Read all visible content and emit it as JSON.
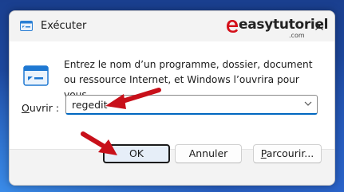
{
  "window": {
    "title": "Exécuter"
  },
  "watermark": {
    "text": "easytutoriel",
    "sub": ".com"
  },
  "dialog": {
    "description": "Entrez le nom d’un programme, dossier, document ou ressource Internet, et Windows l’ouvrira pour vous.",
    "open_label_prefix": "O",
    "open_label_rest": "uvrir :",
    "open_value": "regedit"
  },
  "buttons": {
    "ok": "OK",
    "cancel": "Annuler",
    "browse_prefix": "P",
    "browse_rest": "arcourir..."
  },
  "colors": {
    "accent": "#0067c0",
    "arrow": "#c8101a",
    "wallpaper": "#1f4ea6"
  },
  "icons": {
    "title": "run-app-icon",
    "close": "close-icon",
    "dropdown": "chevron-down-icon",
    "content": "run-dialog-icon"
  }
}
